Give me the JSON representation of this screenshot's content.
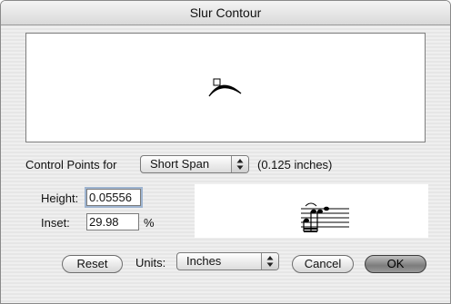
{
  "window": {
    "title": "Slur Contour"
  },
  "control_points": {
    "label": "Control Points for",
    "selected": "Short Span",
    "span_note": "(0.125 inches)"
  },
  "height": {
    "label": "Height:",
    "value": "0.05556"
  },
  "inset": {
    "label": "Inset:",
    "value": "29.98",
    "unit": "%"
  },
  "footer": {
    "reset_label": "Reset",
    "units_label": "Units:",
    "units_selected": "Inches",
    "cancel_label": "Cancel",
    "ok_label": "OK"
  }
}
